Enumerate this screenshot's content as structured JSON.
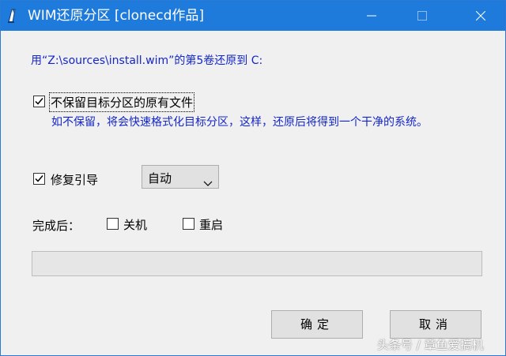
{
  "window": {
    "title": "WIM还原分区  [clonecd作品]",
    "app_icon": "pen-icon",
    "controls": [
      "minimize-icon",
      "maximize-icon",
      "close-icon"
    ],
    "titlebar_color": "#1e7bdc"
  },
  "message": "用“Z:\\sources\\install.wim”的第5卷还原到 C:",
  "keep_files": {
    "label": "不保留目标分区的原有文件",
    "checked": true,
    "hint": "如不保留，将会快速格式化目标分区，这样，还原后将得到一个干净的系统。"
  },
  "repair_boot": {
    "label": "修复引导",
    "checked": true,
    "select_value": "自动"
  },
  "after_complete": {
    "label": "完成后：",
    "shutdown_label": "关机",
    "shutdown_checked": false,
    "restart_label": "重启",
    "restart_checked": false
  },
  "progress": {
    "value": 0
  },
  "buttons": {
    "ok": "确定",
    "cancel": "取消"
  },
  "watermark": "头条号 / 章鱼爱搞机",
  "colors": {
    "accent_text": "#1426c8",
    "progress_fill": "#06b025"
  }
}
